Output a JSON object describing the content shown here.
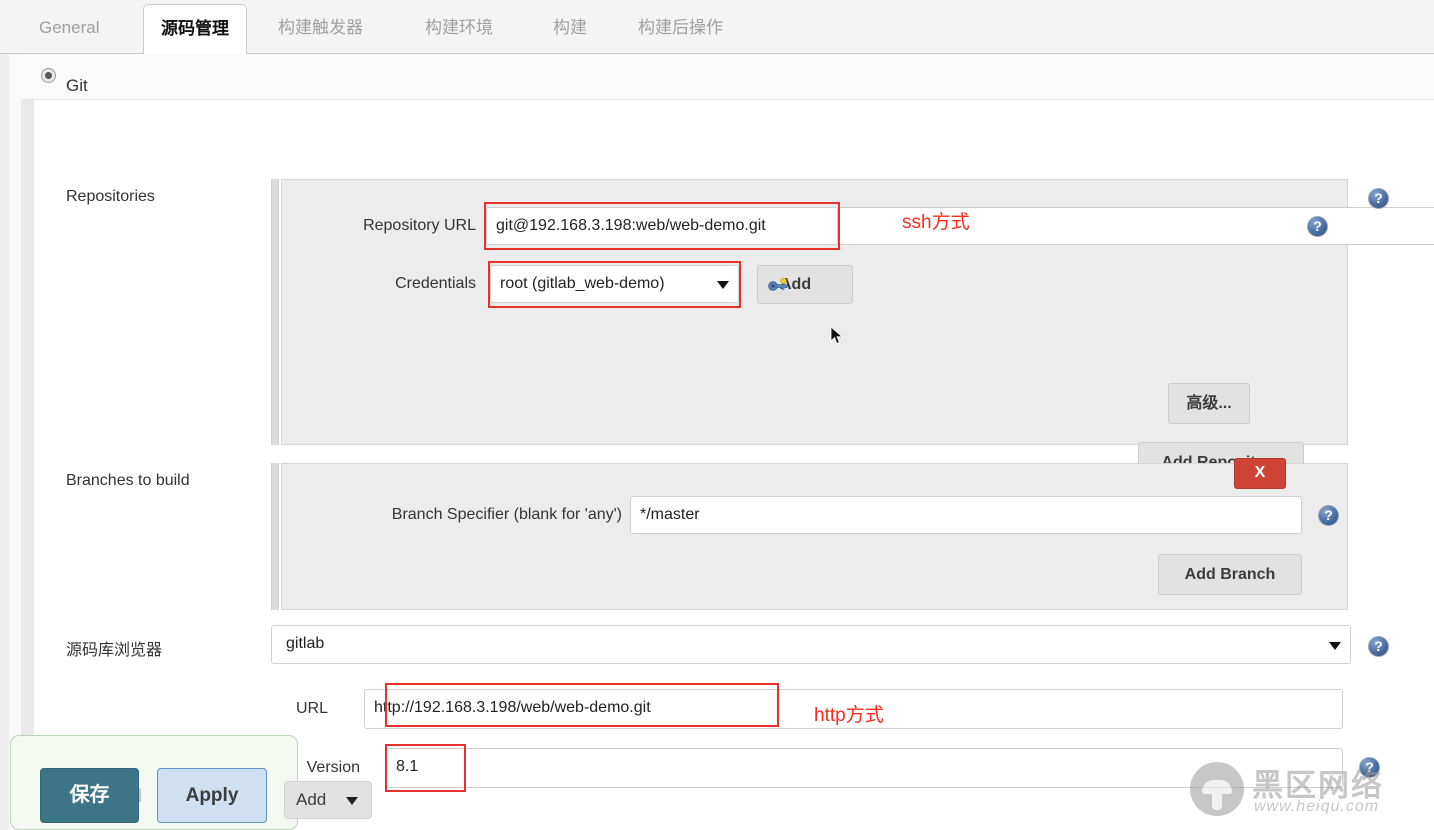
{
  "tabs": [
    {
      "label": "General",
      "active": false
    },
    {
      "label": "源码管理",
      "active": true
    },
    {
      "label": "构建触发器",
      "active": false
    },
    {
      "label": "构建环境",
      "active": false
    },
    {
      "label": "构建",
      "active": false
    },
    {
      "label": "构建后操作",
      "active": false
    }
  ],
  "scm": {
    "radio_label": "Git"
  },
  "repositories": {
    "section_label": "Repositories",
    "url_label": "Repository URL",
    "url_value": "git@192.168.3.198:web/web-demo.git",
    "url_annotation": "ssh方式",
    "credentials_label": "Credentials",
    "credentials_value": "root (gitlab_web-demo)",
    "add_credentials_label": "Add",
    "advanced_label": "高级...",
    "add_repository_label": "Add Repository"
  },
  "branches": {
    "section_label": "Branches to build",
    "specifier_label": "Branch Specifier (blank for 'any')",
    "specifier_value": "*/master",
    "delete_label": "X",
    "add_branch_label": "Add Branch"
  },
  "browser": {
    "section_label": "源码库浏览器",
    "selected": "gitlab",
    "url_label": "URL",
    "url_value": "http://192.168.3.198/web/web-demo.git",
    "url_annotation": "http方式",
    "version_label": "Version",
    "version_value": "8.1"
  },
  "footer": {
    "save_label": "保存",
    "apply_label": "Apply",
    "add_label": "Add",
    "ghost_text": "al"
  },
  "watermark": {
    "name": "黑区网络",
    "url": "www.heiqu.com"
  },
  "help_icon_glyph": "?",
  "colors": {
    "accent_red": "#fe2b1e",
    "save_teal": "#3d7487",
    "apply_blue": "#cfe0f2",
    "delete_red": "#cf4436",
    "help_blue": "#4a6ea3"
  }
}
